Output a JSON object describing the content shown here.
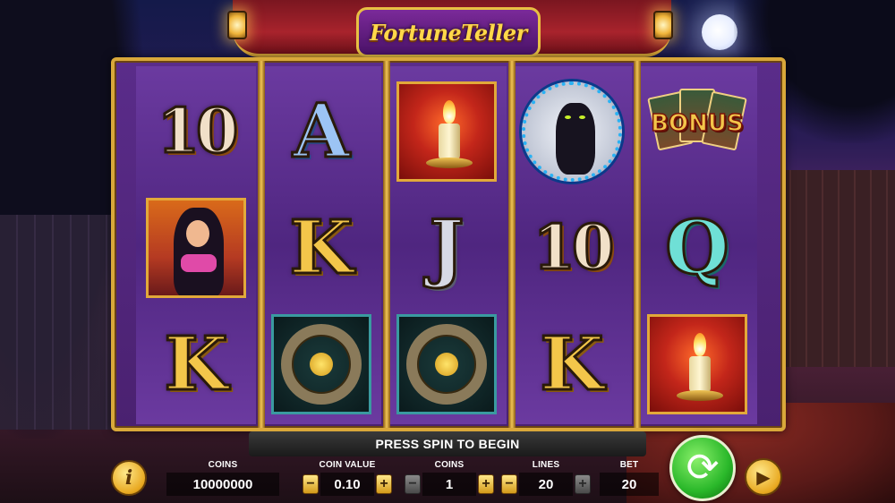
{
  "game": {
    "logo_text": "FortuneTeller"
  },
  "reels": [
    {
      "symbols": [
        {
          "kind": "letter",
          "text": "10",
          "style": "ten"
        },
        {
          "kind": "dancer",
          "name": "dancer"
        },
        {
          "kind": "letter",
          "text": "K",
          "style": "gold"
        }
      ]
    },
    {
      "symbols": [
        {
          "kind": "letter",
          "text": "A",
          "style": "blue"
        },
        {
          "kind": "letter",
          "text": "K",
          "style": "gold"
        },
        {
          "kind": "zodiac",
          "name": "zodiac wheel"
        }
      ]
    },
    {
      "symbols": [
        {
          "kind": "candle",
          "name": "candle"
        },
        {
          "kind": "letter",
          "text": "J",
          "style": "silver"
        },
        {
          "kind": "zodiac",
          "name": "zodiac wheel"
        }
      ]
    },
    {
      "symbols": [
        {
          "kind": "cat",
          "name": "black cat"
        },
        {
          "kind": "letter",
          "text": "10",
          "style": "ten"
        },
        {
          "kind": "letter",
          "text": "K",
          "style": "gold"
        }
      ]
    },
    {
      "symbols": [
        {
          "kind": "bonus",
          "text": "BONUS"
        },
        {
          "kind": "letter",
          "text": "Q",
          "style": "teal"
        },
        {
          "kind": "candle",
          "name": "candle"
        }
      ]
    }
  ],
  "hud": {
    "banner": "PRESS SPIN TO BEGIN",
    "info_label": "i",
    "coins_total": {
      "label": "COINS",
      "value": "10000000"
    },
    "coin_value": {
      "label": "COIN VALUE",
      "value": "0.10",
      "minus": "−",
      "plus": "+"
    },
    "coins": {
      "label": "COINS",
      "value": "1",
      "minus": "−",
      "plus": "+"
    },
    "lines": {
      "label": "LINES",
      "value": "20",
      "minus": "−",
      "plus": "+"
    },
    "bet": {
      "label": "BET",
      "value": "20"
    }
  },
  "icons": {
    "spin": "spin-refresh-icon",
    "autoplay": "autoplay-icon",
    "info": "info-icon"
  },
  "colors": {
    "gold": "#f3c64a",
    "spin_green": "#2ab82a",
    "frame_gold": "#d9a83a",
    "reel_purple": "#5a2c8a"
  }
}
